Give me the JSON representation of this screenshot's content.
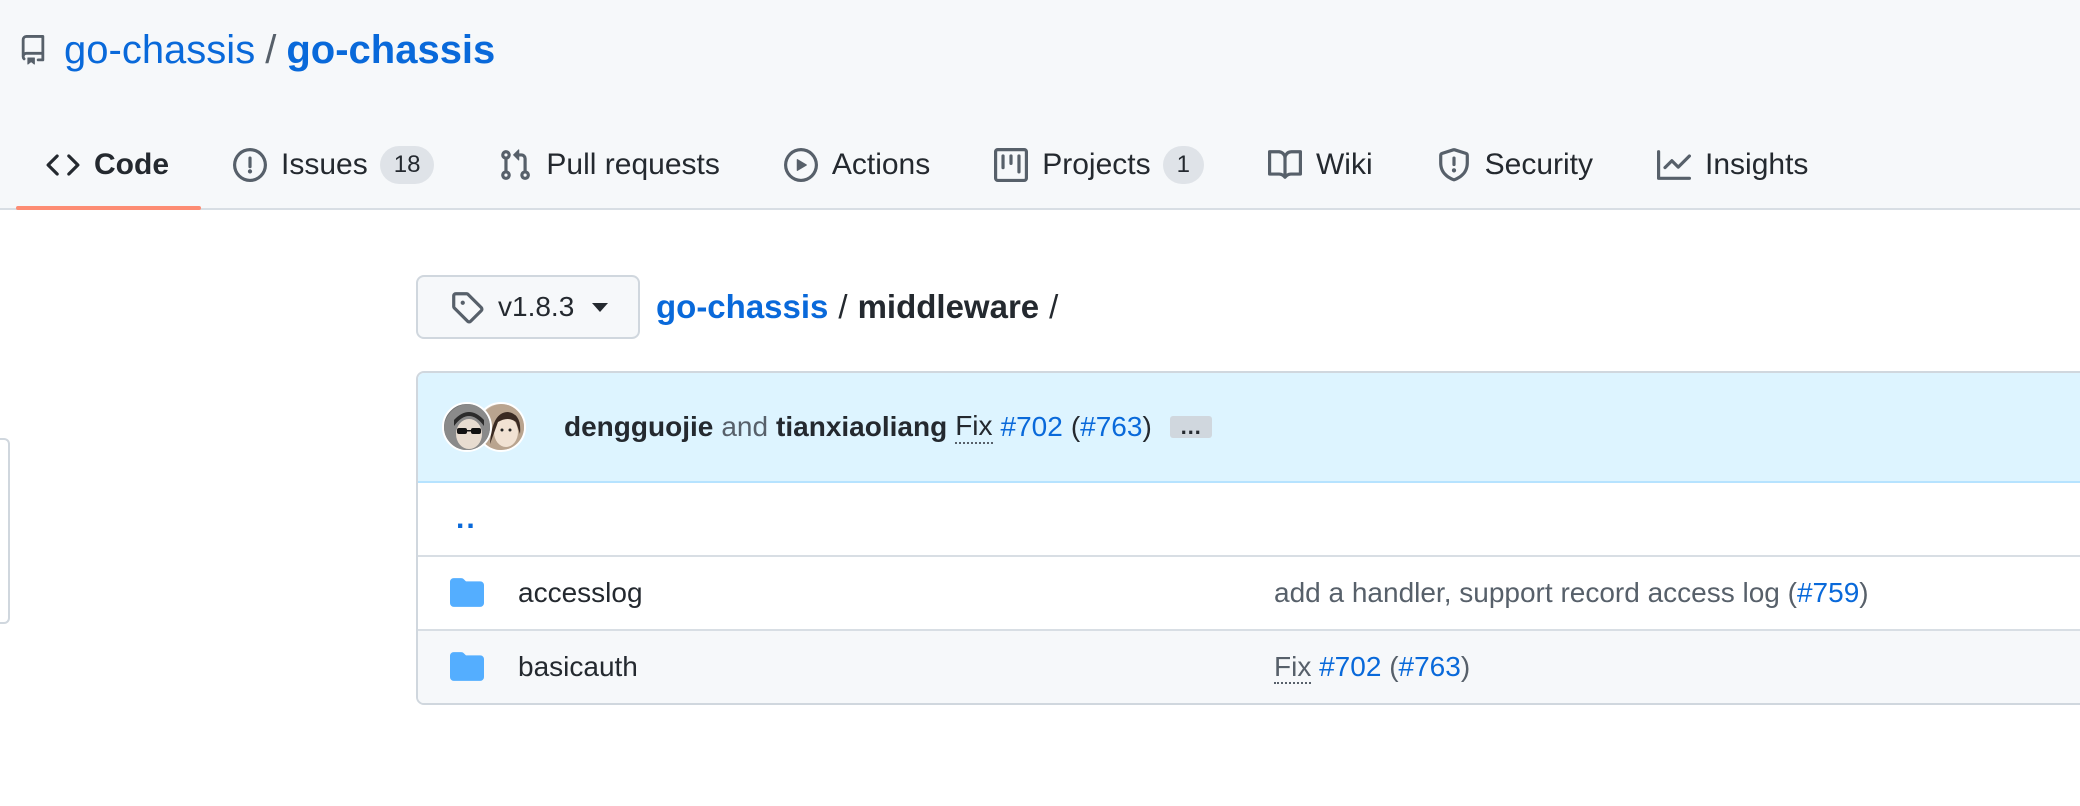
{
  "repo": {
    "owner": "go-chassis",
    "separator": "/",
    "name": "go-chassis"
  },
  "tabs": [
    {
      "label": "Code",
      "icon": "code-icon",
      "selected": true
    },
    {
      "label": "Issues",
      "icon": "issue-opened-icon",
      "count": "18"
    },
    {
      "label": "Pull requests",
      "icon": "git-pull-request-icon"
    },
    {
      "label": "Actions",
      "icon": "play-icon"
    },
    {
      "label": "Projects",
      "icon": "project-icon",
      "count": "1"
    },
    {
      "label": "Wiki",
      "icon": "book-icon"
    },
    {
      "label": "Security",
      "icon": "shield-icon"
    },
    {
      "label": "Insights",
      "icon": "graph-icon"
    }
  ],
  "branch": {
    "label": "v1.8.3",
    "icon": "tag-icon"
  },
  "breadcrumb": {
    "root": "go-chassis",
    "sep1": "/",
    "current": "middleware",
    "sep2": "/"
  },
  "commit": {
    "author1": "dengguojie",
    "and": "and",
    "author2": "tianxiaoliang",
    "fix": "Fix",
    "issue": "#702",
    "open_paren": "(",
    "pr": "#763",
    "close_paren": ")",
    "ellipsis": "…"
  },
  "files": {
    "parent": "..",
    "rows": [
      {
        "name": "accesslog",
        "message": "add a handler, support record access log (",
        "link": "#759",
        "tail": ")"
      },
      {
        "name": "basicauth",
        "fix": "Fix",
        "issue": "#702",
        "open_paren": "(",
        "pr": "#763",
        "tail": ")"
      }
    ]
  },
  "colors": {
    "link": "#0969da",
    "tab_underline": "#fd8c73",
    "commit_bg": "#ddf4ff",
    "folder": "#54aeff"
  }
}
